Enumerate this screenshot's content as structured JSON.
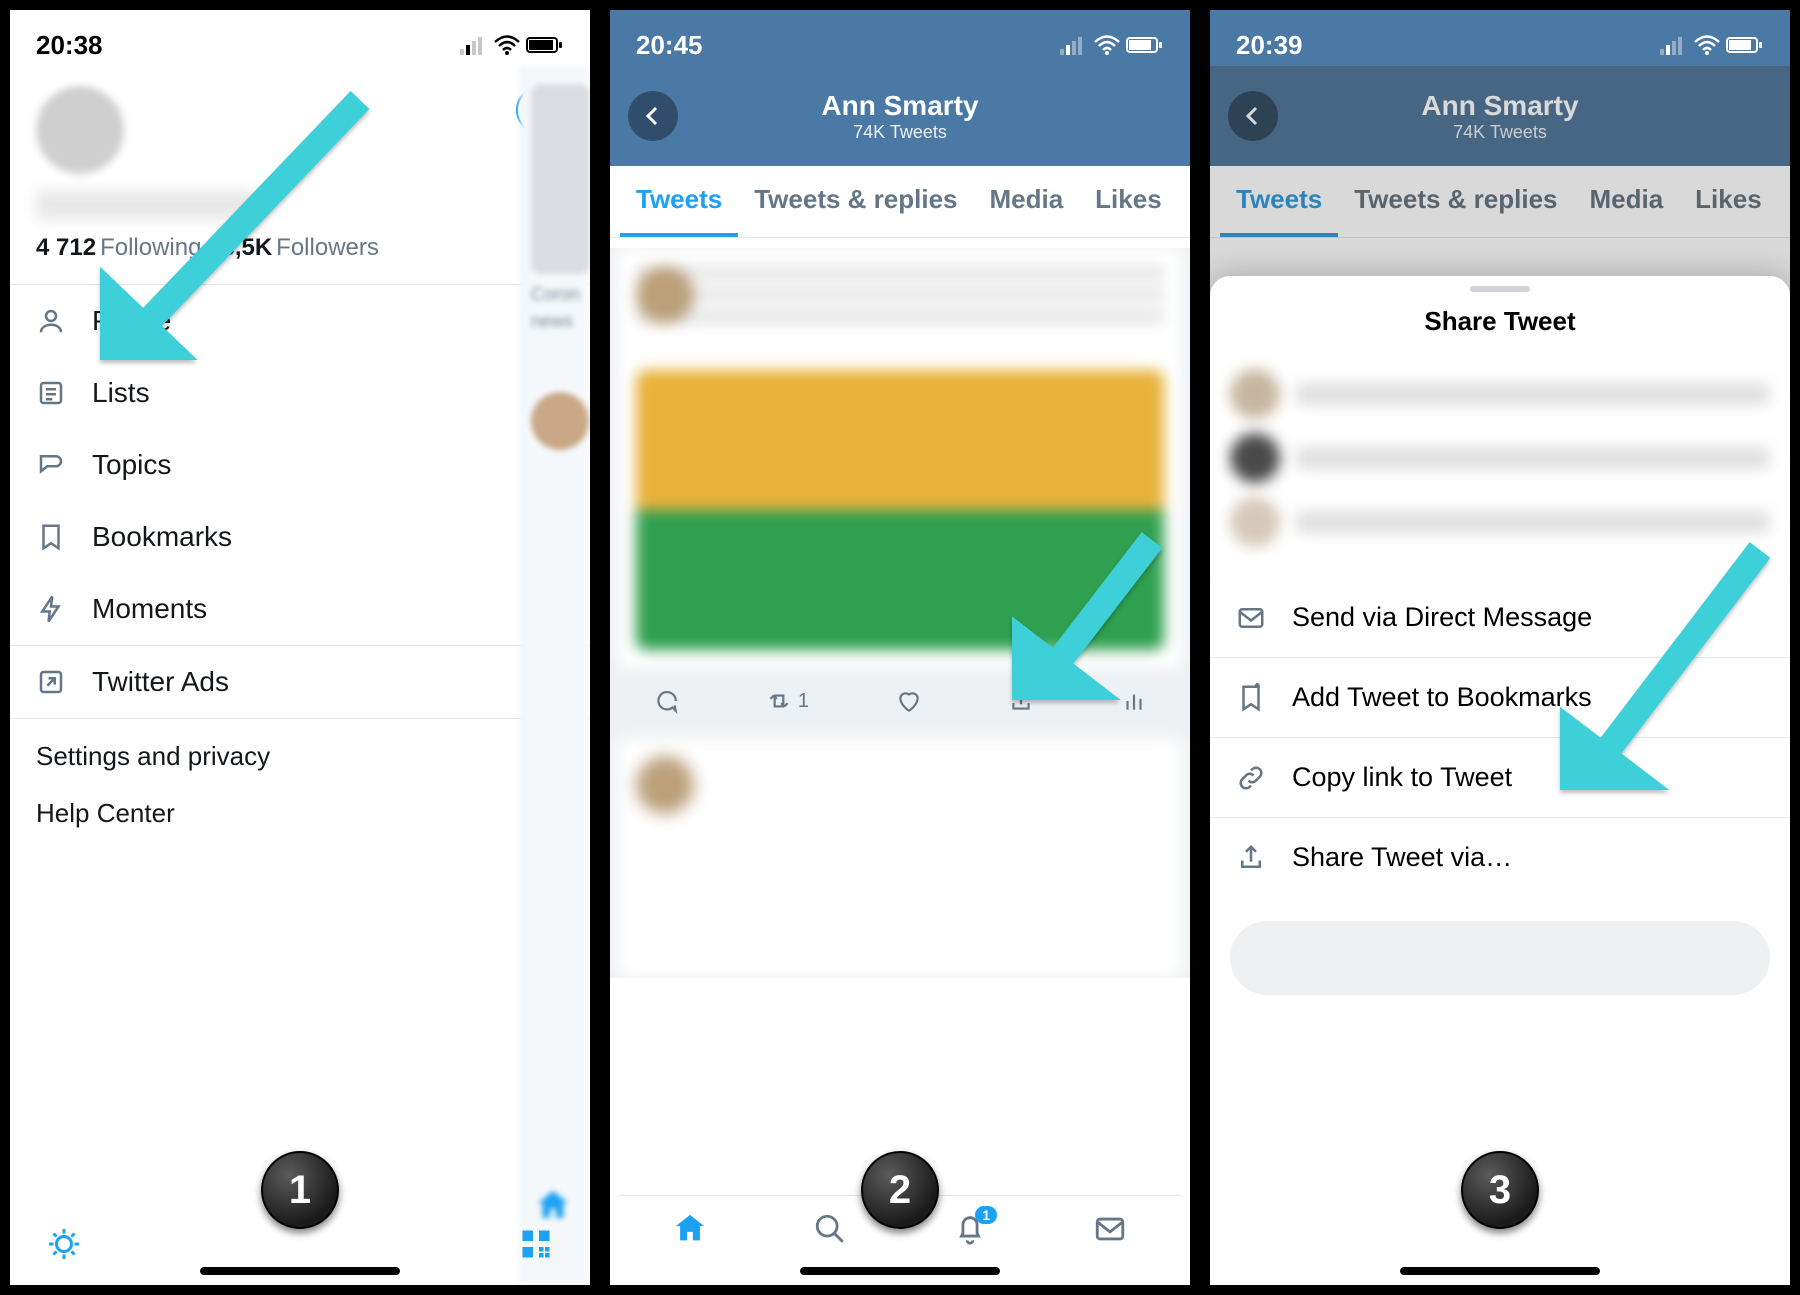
{
  "screen1": {
    "time": "20:38",
    "following_count": "4 712",
    "following_label": "Following",
    "followers_count": "6,5K",
    "followers_label": "Followers",
    "menu": {
      "profile": "Profile",
      "lists": "Lists",
      "topics": "Topics",
      "bookmarks": "Bookmarks",
      "moments": "Moments",
      "ads": "Twitter Ads"
    },
    "settings": "Settings and privacy",
    "help": "Help Center",
    "peek": {
      "l1": "Coron",
      "l2": "news"
    },
    "badge": "1"
  },
  "screen2": {
    "time": "20:45",
    "title": "Ann Smarty",
    "subtitle": "74K Tweets",
    "tabs": [
      "Tweets",
      "Tweets & replies",
      "Media",
      "Likes"
    ],
    "retweet_count": "1",
    "notif_badge": "1",
    "badge": "2"
  },
  "screen3": {
    "time": "20:39",
    "title": "Ann Smarty",
    "subtitle": "74K Tweets",
    "tabs": [
      "Tweets",
      "Tweets & replies",
      "Media",
      "Likes"
    ],
    "sheet_title": "Share Tweet",
    "options": {
      "dm": "Send via Direct Message",
      "bookmark": "Add Tweet to Bookmarks",
      "copy": "Copy link to Tweet",
      "share": "Share Tweet via…"
    },
    "badge": "3"
  }
}
